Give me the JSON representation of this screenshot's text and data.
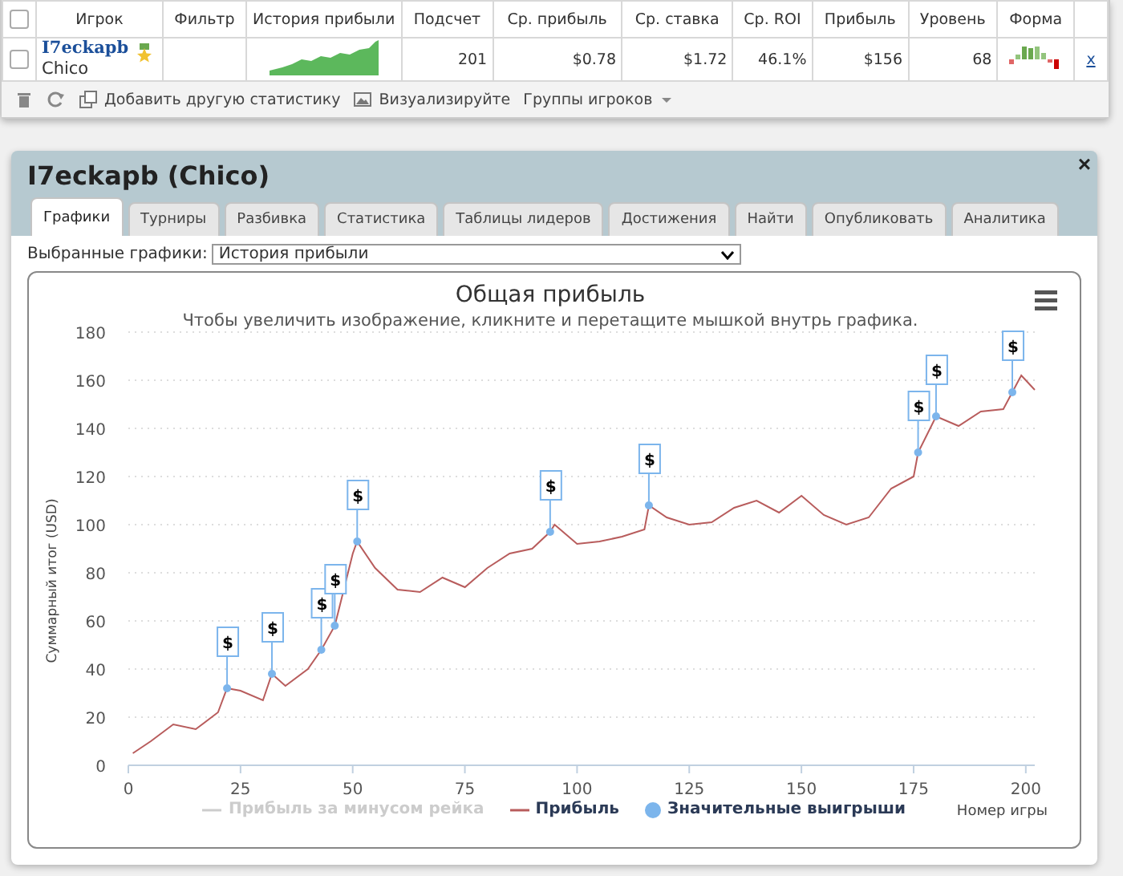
{
  "stats_table": {
    "select_all": {
      "checked": false
    },
    "columns": [
      "Игрок",
      "Фильтр",
      "История прибыли",
      "Подсчет",
      "Ср. прибыль",
      "Ср. ставка",
      "Ср. ROI",
      "Прибыль",
      "Уровень",
      "Форма"
    ],
    "rows": [
      {
        "checked": false,
        "player": "I7eckapb",
        "site": "Chico",
        "filter": "",
        "count": "201",
        "avg_profit": "$0.78",
        "avg_stake": "$1.72",
        "avg_roi": "46.1%",
        "profit": "$156",
        "level": "68",
        "remove": "x"
      }
    ]
  },
  "toolbar": {
    "add_stat": "Добавить другую статистику",
    "visualize": "Визуализируйте",
    "groups": "Группы игроков"
  },
  "dialog": {
    "title": "I7eckapb (Chico)",
    "close": "×",
    "tabs": [
      {
        "label": "Графики",
        "selected": true
      },
      {
        "label": "Турниры",
        "selected": false
      },
      {
        "label": "Разбивка",
        "selected": false
      },
      {
        "label": "Статистика",
        "selected": false
      },
      {
        "label": "Таблицы лидеров",
        "selected": false
      },
      {
        "label": "Достижения",
        "selected": false
      },
      {
        "label": "Найти",
        "selected": false
      },
      {
        "label": "Опубликовать",
        "selected": false
      },
      {
        "label": "Аналитика",
        "selected": false
      }
    ],
    "chart_select": {
      "label": "Выбранные графики:",
      "value": "История прибыли"
    },
    "chart": {
      "chart_data": {
        "type": "line",
        "title": "Общая прибыль",
        "subtitle": "Чтобы увеличить изображение, кликните и перетащите мышкой внутрь графика.",
        "xlabel": "Номер игры",
        "ylabel": "Суммарный итог (USD)",
        "x": [
          1,
          5,
          10,
          15,
          20,
          22,
          25,
          30,
          32,
          35,
          40,
          43,
          46,
          50,
          51,
          55,
          60,
          65,
          70,
          75,
          80,
          85,
          90,
          94,
          95,
          100,
          105,
          110,
          115,
          116,
          120,
          125,
          130,
          135,
          140,
          145,
          150,
          155,
          160,
          165,
          170,
          175,
          176,
          180,
          185,
          190,
          195,
          197,
          199,
          202
        ],
        "series": [
          {
            "name": "Прибыль",
            "color": "#b85c5c",
            "values": [
              5,
              10,
              17,
              15,
              22,
              32,
              31,
              27,
              38,
              33,
              40,
              48,
              58,
              88,
              93,
              82,
              73,
              72,
              78,
              74,
              82,
              88,
              90,
              97,
              100,
              92,
              93,
              95,
              98,
              108,
              103,
              100,
              101,
              107,
              110,
              105,
              112,
              104,
              100,
              103,
              115,
              120,
              130,
              145,
              141,
              147,
              148,
              155,
              162,
              156
            ]
          },
          {
            "name": "Значительные выигрыши",
            "type": "scatter",
            "color": "#7cb5ec",
            "values": [
              null,
              null,
              null,
              null,
              null,
              32,
              null,
              null,
              38,
              null,
              null,
              48,
              58,
              null,
              93,
              null,
              null,
              null,
              null,
              null,
              null,
              null,
              null,
              97,
              null,
              null,
              null,
              null,
              null,
              108,
              null,
              null,
              null,
              null,
              null,
              null,
              null,
              null,
              null,
              null,
              null,
              null,
              130,
              145,
              null,
              null,
              null,
              155,
              null,
              null
            ]
          }
        ],
        "xlim": [
          0,
          202
        ],
        "ylim": [
          0,
          180
        ],
        "xticks": [
          0,
          25,
          50,
          75,
          100,
          125,
          150,
          175,
          200
        ],
        "yticks": [
          0,
          20,
          40,
          60,
          80,
          100,
          120,
          140,
          160,
          180
        ],
        "grid": true,
        "legend": "bottom"
      },
      "flags": [
        "$",
        "$",
        "$",
        "$",
        "$",
        "$",
        "$",
        "$",
        "$",
        "$"
      ],
      "legend": [
        {
          "kind": "line",
          "label": "Прибыль за минусом рейка",
          "disabled": true,
          "color": "#cccccc"
        },
        {
          "kind": "series",
          "disabled": false
        },
        {
          "kind": "series_dot",
          "disabled": false
        }
      ]
    }
  }
}
